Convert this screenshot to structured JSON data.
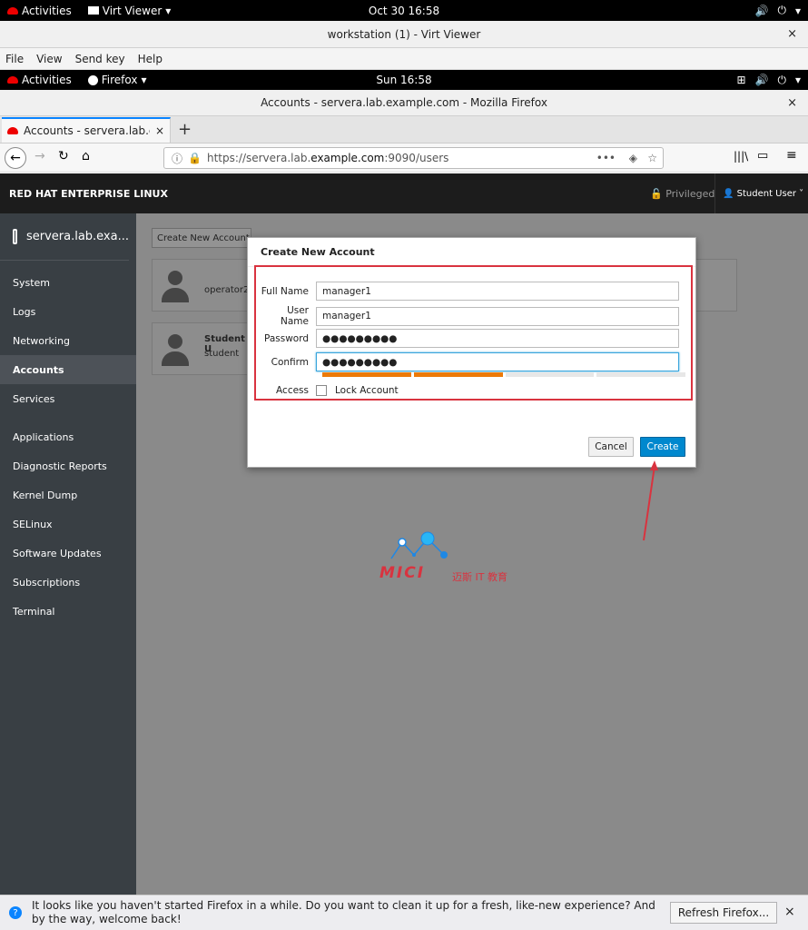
{
  "host_topbar": {
    "activities": "Activities",
    "app_menu": "Virt Viewer",
    "clock": "Oct 30  16:58"
  },
  "host_window": {
    "title": "workstation (1) - Virt Viewer",
    "close": "×",
    "menu": [
      "File",
      "View",
      "Send key",
      "Help"
    ]
  },
  "guest_topbar": {
    "activities": "Activities",
    "app_menu": "Firefox",
    "clock": "Sun 16:58"
  },
  "firefox_window": {
    "title": "Accounts - servera.lab.example.com - Mozilla Firefox",
    "close": "×"
  },
  "tab": {
    "label": "Accounts - servera.lab.ex",
    "close": "×",
    "new": "+"
  },
  "urlbar": {
    "prefix": "https://servera.lab.",
    "host": "example.com",
    "suffix": ":9090/users",
    "more": "•••"
  },
  "cockpit": {
    "brand": "RED HAT ENTERPRISE LINUX",
    "privileged": "Privileged",
    "user": "Student User ˅",
    "host": "servera.lab.exa..."
  },
  "sidebar": {
    "items": [
      "System",
      "Logs",
      "Networking",
      "Accounts",
      "Services",
      "Applications",
      "Diagnostic Reports",
      "Kernel Dump",
      "SELinux",
      "Software Updates",
      "Subscriptions",
      "Terminal"
    ]
  },
  "accounts": {
    "create_button": "Create New Account",
    "cards": [
      {
        "name": "",
        "username": "operator2"
      },
      {
        "name": "Student U",
        "username": "student"
      }
    ]
  },
  "dialog": {
    "title": "Create New Account",
    "fields": {
      "full_name_label": "Full Name",
      "full_name": "manager1",
      "user_name_label": "User Name",
      "user_name": "manager1",
      "password_label": "Password",
      "password": "●●●●●●●●●",
      "confirm_label": "Confirm",
      "confirm": "●●●●●●●●●",
      "access_label": "Access",
      "lock_label": "Lock Account"
    },
    "cancel": "Cancel",
    "create": "Create",
    "strength_segments_filled": 2
  },
  "watermark": {
    "brand": "MICI",
    "subtitle": "迈斯 IT 教育"
  },
  "colors": {
    "accent": "#0088ce",
    "meter": "#ec7a08",
    "highlight": "#d9333f"
  },
  "infobar": {
    "message": "It looks like you haven't started Firefox in a while. Do you want to clean it up for a fresh, like-new experience? And by the way, welcome back!",
    "refresh": "Refresh Firefox...",
    "close": "×"
  }
}
